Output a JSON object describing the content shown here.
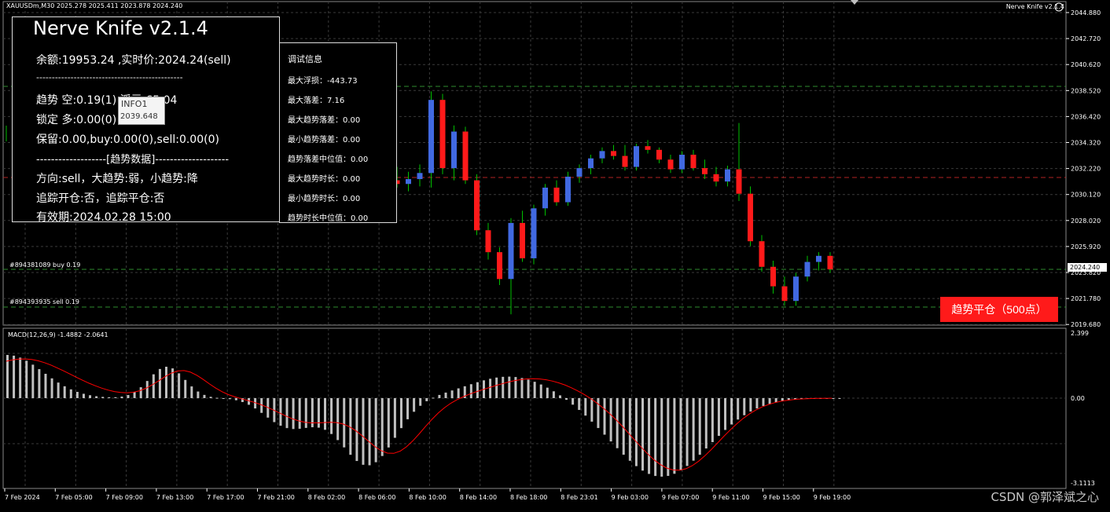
{
  "header": {
    "symbol_line": "XAUUSDm,M30  2025.278 2025.411 2023.878 2024.240",
    "ea_name": "Nerve Knife v2.1.4"
  },
  "info_panel": {
    "title": "Nerve Knife v2.1.4",
    "balance_line": "余额:19953.24 ,实时价:2024.24(sell)",
    "separator1": "-----------------------------------------------",
    "trend_line": "趋势 空:0.19(1)    浮亏:65.04",
    "lock_line": "锁定 多:0.00(0)                    .00",
    "keep_line": "保留:0.00,buy:0.00(0),sell:0.00(0)",
    "section": "-------------------[趋势数据]--------------------",
    "direction_line": "方向:sell，大趋势:弱，小趋势:降",
    "track_line": "追踪开仓:否，追踪平仓:否",
    "valid_line": "有效期:2024.02.28 15:00"
  },
  "tooltip": {
    "name": "INFO1",
    "value": "2039.648"
  },
  "debug_panel": {
    "title": "调试信息",
    "lines": [
      "最大浮损：-443.73",
      "最大落差：7.16",
      "最大趋势落差：0.00",
      "最小趋势落差：0.00",
      "趋势落差中位值：0.00",
      "最大趋势时长：0.00",
      "最小趋势时长：0.00",
      "趋势时长中位值：0.00"
    ]
  },
  "order_lines": {
    "buy": "#894381089 buy 0.19",
    "sell": "#894393935 sell 0.19"
  },
  "close_button": "趋势平仓（500点）",
  "macd_label": "MACD(12,26,9) -1.4882 -2.0641",
  "watermark": "CSDN @郭泽斌之心",
  "price_axis": [
    "2044.880",
    "2042.720",
    "2040.620",
    "2038.520",
    "2036.420",
    "2034.320",
    "2032.220",
    "2030.120",
    "2028.020",
    "2025.920",
    "2023.820",
    "2021.780",
    "2019.680"
  ],
  "current_price": "2024.240",
  "macd_axis": [
    "2.399",
    "0.00",
    "-3.1113"
  ],
  "time_axis": [
    "7 Feb 2024",
    "7 Feb 05:00",
    "7 Feb 09:00",
    "7 Feb 13:00",
    "7 Feb 17:00",
    "7 Feb 21:00",
    "8 Feb 02:00",
    "8 Feb 06:00",
    "8 Feb 10:00",
    "8 Feb 14:00",
    "8 Feb 18:00",
    "8 Feb 23:01",
    "9 Feb 03:00",
    "9 Feb 07:00",
    "9 Feb 11:00",
    "9 Feb 15:00",
    "9 Feb 19:00"
  ],
  "colors": {
    "background": "#000000",
    "grid": "#3a3a3a",
    "bull_candle": "#4169e1",
    "bear_candle": "#ff1a1a",
    "wick_up": "#00c000",
    "level_line": "#2e8b2e",
    "macd_hist": "#c0c0c0",
    "macd_signal": "#ff0000",
    "button_bg": "#ff1a1a"
  },
  "chart_data": {
    "type": "candlestick",
    "price_range": [
      2019.68,
      2044.88
    ],
    "candles_ohlc": [
      [
        2031.5,
        2032.6,
        2030.9,
        2031.2
      ],
      [
        2031.2,
        2032.2,
        2030.6,
        2031.6
      ],
      [
        2031.6,
        2032.8,
        2031.0,
        2032.1
      ],
      [
        2032.1,
        2038.8,
        2030.9,
        2038.1
      ],
      [
        2038.1,
        2038.6,
        2032.0,
        2032.5
      ],
      [
        2032.5,
        2036.0,
        2031.5,
        2035.5
      ],
      [
        2035.5,
        2035.9,
        2031.2,
        2031.5
      ],
      [
        2031.5,
        2032.0,
        2027.0,
        2027.4
      ],
      [
        2027.4,
        2028.0,
        2025.0,
        2025.6
      ],
      [
        2025.6,
        2026.0,
        2022.9,
        2023.4
      ],
      [
        2023.4,
        2028.4,
        2020.5,
        2028.0
      ],
      [
        2028.0,
        2029.0,
        2024.8,
        2025.1
      ],
      [
        2025.1,
        2029.5,
        2024.6,
        2029.2
      ],
      [
        2029.2,
        2031.2,
        2028.6,
        2030.9
      ],
      [
        2030.9,
        2031.5,
        2029.4,
        2029.7
      ],
      [
        2029.7,
        2032.2,
        2029.4,
        2031.8
      ],
      [
        2031.8,
        2032.8,
        2031.3,
        2032.5
      ],
      [
        2032.5,
        2033.6,
        2032.0,
        2033.3
      ],
      [
        2033.3,
        2034.2,
        2032.9,
        2033.9
      ],
      [
        2033.9,
        2034.4,
        2033.2,
        2033.5
      ],
      [
        2033.5,
        2034.4,
        2032.3,
        2032.6
      ],
      [
        2032.6,
        2034.5,
        2032.3,
        2034.3
      ],
      [
        2034.3,
        2034.8,
        2033.7,
        2034.0
      ],
      [
        2034.0,
        2034.2,
        2032.9,
        2033.2
      ],
      [
        2033.2,
        2033.6,
        2032.1,
        2032.4
      ],
      [
        2032.4,
        2033.9,
        2032.1,
        2033.6
      ],
      [
        2033.6,
        2034.0,
        2032.3,
        2032.5
      ],
      [
        2032.5,
        2033.2,
        2031.6,
        2032.0
      ],
      [
        2032.0,
        2032.6,
        2031.0,
        2031.4
      ],
      [
        2031.4,
        2032.7,
        2031.0,
        2032.4
      ],
      [
        2032.4,
        2036.2,
        2029.8,
        2030.4
      ],
      [
        2030.4,
        2031.0,
        2026.1,
        2026.5
      ],
      [
        2026.5,
        2027.0,
        2024.0,
        2024.4
      ],
      [
        2024.4,
        2024.9,
        2022.2,
        2022.8
      ],
      [
        2022.8,
        2023.6,
        2021.2,
        2021.6
      ],
      [
        2021.6,
        2023.9,
        2021.2,
        2023.6
      ],
      [
        2023.6,
        2025.3,
        2023.2,
        2024.8
      ],
      [
        2024.8,
        2025.6,
        2024.1,
        2025.3
      ],
      [
        2025.3,
        2025.6,
        2023.9,
        2024.2
      ]
    ],
    "macd": {
      "value": -1.4882,
      "signal": -2.0641,
      "range": [
        -3.1113,
        2.399
      ]
    }
  }
}
